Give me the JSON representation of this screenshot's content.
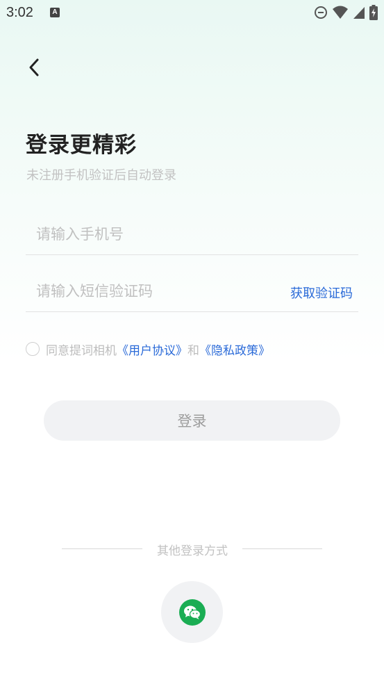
{
  "status_bar": {
    "time": "3:02",
    "a_icon_letter": "A",
    "icons": [
      "dnd-icon",
      "wifi-icon",
      "signal-icon",
      "battery-charging-icon"
    ]
  },
  "header": {
    "back_icon": "chevron-left-icon",
    "title": "登录更精彩",
    "subtitle": "未注册手机验证后自动登录"
  },
  "form": {
    "phone_placeholder": "请输入手机号",
    "phone_value": "",
    "code_placeholder": "请输入短信验证码",
    "code_value": "",
    "get_code_label": "获取验证码"
  },
  "agreement": {
    "checked": false,
    "prefix": "同意提词相机",
    "user_agreement": "《用户协议》",
    "conjunction": "和",
    "privacy_policy": "《隐私政策》"
  },
  "login_button_label": "登录",
  "other_login": {
    "label": "其他登录方式",
    "providers": [
      "wechat-icon"
    ]
  },
  "colors": {
    "accent_link": "#2a6ad8",
    "wechat_green": "#1aad53",
    "button_bg": "#f1f2f4"
  }
}
